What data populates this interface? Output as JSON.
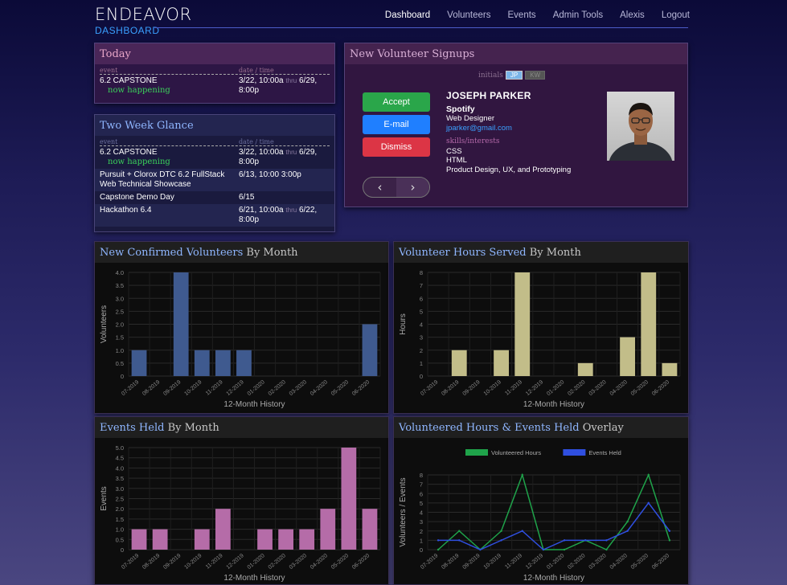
{
  "header": {
    "logo": "ENDEAVOR",
    "logo_sub": "DASHBOARD",
    "nav": [
      "Dashboard",
      "Volunteers",
      "Events",
      "Admin Tools",
      "Alexis",
      "Logout"
    ]
  },
  "today": {
    "title": "Today",
    "col_event": "event",
    "col_date": "date / time",
    "rows": [
      {
        "event": "6.2 CAPSTONE",
        "status": "now happening",
        "date_start": "3/22, 10:00a",
        "thru": "thru",
        "date_end": "6/29, 8:00p"
      }
    ]
  },
  "twoweek": {
    "title": "Two Week Glance",
    "col_event": "event",
    "col_date": "date / time",
    "rows": [
      {
        "event": "6.2 CAPSTONE",
        "status": "now happening",
        "date": "3/22, 10:00a",
        "thru": "thru",
        "date_end": "6/29, 8:00p"
      },
      {
        "event": "Pursuit + Clorox DTC 6.2 FullStack Web Technical Showcase",
        "date": "6/13, 10:00   3:00p"
      },
      {
        "event": "Capstone Demo Day",
        "date": "6/15"
      },
      {
        "event": "Hackathon 6.4",
        "date": "6/21, 10:00a",
        "thru": "thru",
        "date_end": "6/22, 8:00p"
      }
    ]
  },
  "signups": {
    "title": "New Volunteer Signups",
    "initials_label": "initials",
    "initials": [
      "JP",
      "KW"
    ],
    "buttons": {
      "accept": "Accept",
      "email": "E-mail",
      "dismiss": "Dismiss"
    },
    "pager": {
      "prev": "‹",
      "next": "›"
    },
    "person": {
      "name": "JOSEPH PARKER",
      "company": "Spotify",
      "title": "Web Designer",
      "email": "jparker@gmail.com",
      "skills_label": "skills/interests",
      "skills": [
        "CSS",
        "HTML",
        "Product Design, UX, and Prototyping"
      ]
    }
  },
  "chart_data": [
    {
      "type": "bar",
      "title_hl": "New Confirmed Volunteers",
      "title_rest": " By Month",
      "xlabel": "12-Month History",
      "ylabel": "Volunteers",
      "categories": [
        "07-2019",
        "08-2019",
        "09-2019",
        "10-2019",
        "11-2019",
        "12-2019",
        "01-2020",
        "02-2020",
        "03-2020",
        "04-2020",
        "05-2020",
        "06-2020"
      ],
      "values": [
        1,
        0,
        4,
        1,
        1,
        1,
        0,
        0,
        0,
        0,
        0,
        2
      ],
      "ylim": [
        0,
        4
      ],
      "yticks": [
        "0",
        "0.5",
        "1.0",
        "1.5",
        "2.0",
        "2.5",
        "3.0",
        "3.5",
        "4.0"
      ],
      "color": "#3f5a8f"
    },
    {
      "type": "bar",
      "title_hl": "Volunteer Hours Served",
      "title_rest": " By Month",
      "xlabel": "12-Month History",
      "ylabel": "Hours",
      "categories": [
        "07-2019",
        "08-2019",
        "09-2019",
        "10-2019",
        "11-2019",
        "12-2019",
        "01-2020",
        "02-2020",
        "03-2020",
        "04-2020",
        "05-2020",
        "06-2020"
      ],
      "values": [
        0,
        2,
        0,
        2,
        8,
        0,
        0,
        1,
        0,
        3,
        8,
        1
      ],
      "ylim": [
        0,
        8
      ],
      "yticks": [
        "0",
        "1",
        "2",
        "3",
        "4",
        "5",
        "6",
        "7",
        "8"
      ],
      "color": "#c2bd89"
    },
    {
      "type": "bar",
      "title_hl": "Events Held",
      "title_rest": " By Month",
      "xlabel": "12-Month History",
      "ylabel": "Events",
      "categories": [
        "07-2019",
        "08-2019",
        "09-2019",
        "10-2019",
        "11-2019",
        "12-2019",
        "01-2020",
        "02-2020",
        "03-2020",
        "04-2020",
        "05-2020",
        "06-2020"
      ],
      "values": [
        1,
        1,
        0,
        1,
        2,
        0,
        1,
        1,
        1,
        2,
        5,
        2
      ],
      "ylim": [
        0,
        5
      ],
      "yticks": [
        "0",
        "0.5",
        "1.0",
        "1.5",
        "2.0",
        "2.5",
        "3.0",
        "3.5",
        "4.0",
        "4.5",
        "5.0"
      ],
      "color": "#b56ca8"
    },
    {
      "type": "line",
      "title_hl": "Volunteered Hours & Events Held",
      "title_rest": " Overlay",
      "xlabel": "12-Month History",
      "ylabel": "Volunteers / Events",
      "categories": [
        "07-2019",
        "08-2019",
        "09-2019",
        "10-2019",
        "11-2019",
        "12-2019",
        "01-2020",
        "02-2020",
        "03-2020",
        "04-2020",
        "05-2020",
        "06-2020"
      ],
      "ylim": [
        0,
        8
      ],
      "yticks": [
        "0",
        "1",
        "2",
        "3",
        "4",
        "5",
        "6",
        "7",
        "8"
      ],
      "series": [
        {
          "name": "Volunteered Hours",
          "values": [
            0,
            2,
            0,
            2,
            8,
            0,
            0,
            1,
            0,
            3,
            8,
            1
          ],
          "color": "#1fa34a"
        },
        {
          "name": "Events Held",
          "values": [
            1,
            1,
            0,
            1,
            2,
            0,
            1,
            1,
            1,
            2,
            5,
            2
          ],
          "color": "#2f4fe0"
        }
      ]
    }
  ]
}
